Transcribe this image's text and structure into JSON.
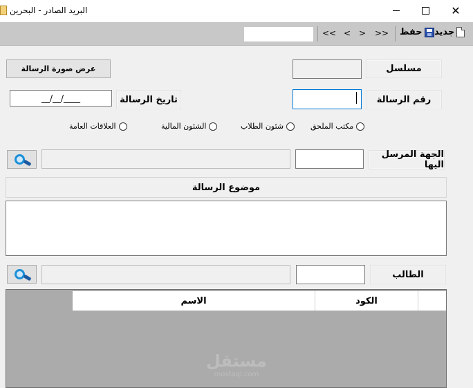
{
  "window": {
    "title": "البريد الصادر - البحرين",
    "min_icon": "minimize-icon",
    "max_icon": "maximize-icon",
    "close_icon": "close-icon",
    "close_glyph": "✕"
  },
  "toolbar": {
    "search_value": "",
    "nav_first": "<<",
    "nav_prev": "<",
    "nav_next": ">",
    "nav_last": ">>",
    "save_label": "حفظ",
    "new_label": "جديد"
  },
  "form": {
    "serial_label": "مسلسل",
    "serial_value": "",
    "view_image_button": "عرض صورة الرسالة",
    "letter_number_label": "رقم الرسالة",
    "letter_number_value": "",
    "letter_date_label": "تاريخ الرسالة",
    "letter_date_value": "__/__/____",
    "radio_options": [
      {
        "label": "مكتب الملحق"
      },
      {
        "label": "شئون الطلاب"
      },
      {
        "label": "الشئون المالية"
      },
      {
        "label": "العلاقات العامة"
      }
    ],
    "recipient_label": "الجهة المرسل اليها",
    "recipient_code": "",
    "recipient_name": "",
    "subject_header": "موضوع الرسالة",
    "subject_text": "",
    "student_label": "الطالب",
    "student_code": "",
    "student_name": ""
  },
  "grid": {
    "columns": [
      "الكود",
      "الاسم"
    ]
  },
  "watermark": {
    "main": "مستقل",
    "sub": "mostaql.com"
  },
  "colors": {
    "toolbar_bg": "#c8c8c8",
    "form_bg": "#f0f0f0",
    "grid_bg": "#ababab",
    "focus_border": "#0078d7",
    "search_icon": "#1c8fd8"
  }
}
